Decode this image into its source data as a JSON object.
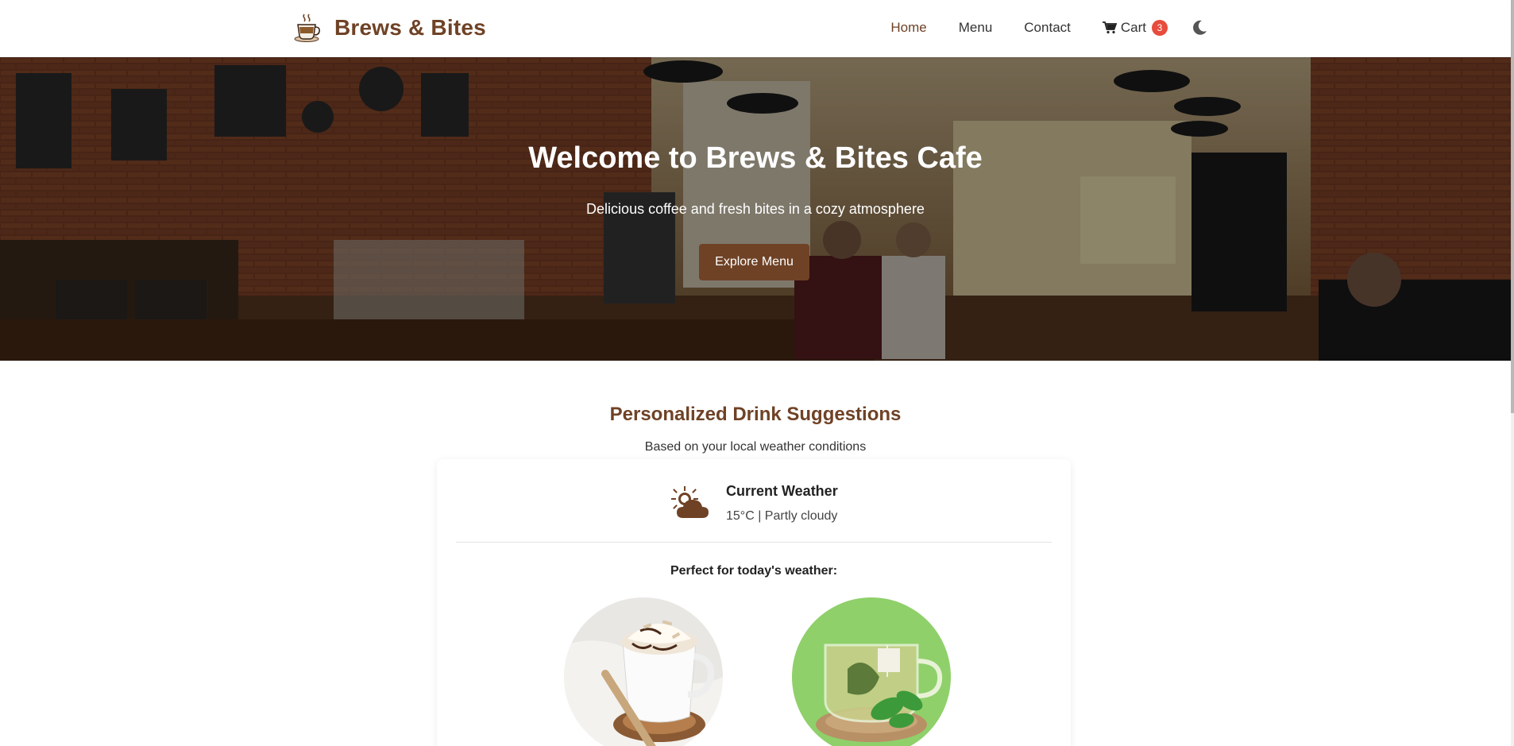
{
  "header": {
    "brand": "Brews & Bites",
    "logo_icon": "coffee-cup-icon",
    "nav": [
      {
        "label": "Home",
        "active": true
      },
      {
        "label": "Menu",
        "active": false
      },
      {
        "label": "Contact",
        "active": false
      }
    ],
    "cart": {
      "label": "Cart",
      "count": "3",
      "icon": "shopping-cart-icon"
    },
    "theme_toggle_icon": "moon-icon"
  },
  "hero": {
    "title": "Welcome to Brews & Bites Cafe",
    "subtitle": "Delicious coffee and fresh bites in a cozy atmosphere",
    "button_label": "Explore Menu"
  },
  "suggestions": {
    "title": "Personalized Drink Suggestions",
    "subtitle": "Based on your local weather conditions",
    "weather": {
      "icon": "partly-cloudy-icon",
      "label": "Current Weather",
      "description": "15°C | Partly cloudy"
    },
    "perfect_label": "Perfect for today's weather:"
  },
  "colors": {
    "brand": "#6f4226",
    "badge": "#e74c3c",
    "text": "#333333"
  }
}
